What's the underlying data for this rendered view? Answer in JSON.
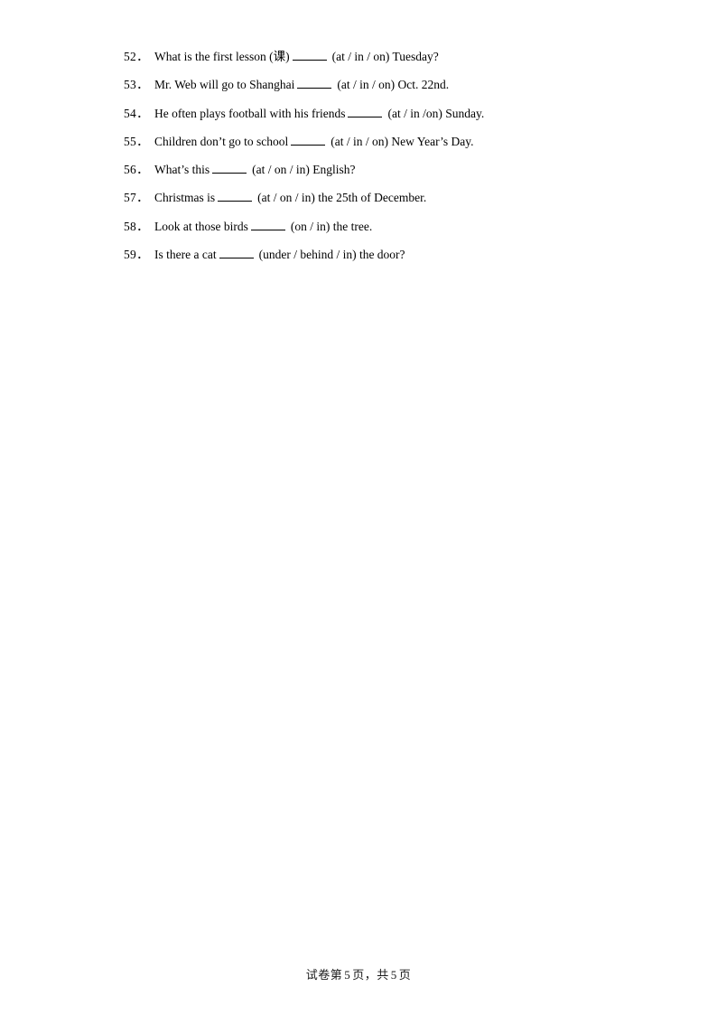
{
  "document": {
    "page_number": "5",
    "total_pages": "5",
    "background_color": "#ffffff",
    "text_color": "#000000"
  },
  "questions": [
    {
      "number": "52",
      "separator": "．",
      "before_blank": "What is the first lesson (课)",
      "after_blank": "(at / in / on) Tuesday?",
      "full_text": "52．What is the first lesson (课) _____ (at / in / on) Tuesday?"
    },
    {
      "number": "53",
      "separator": "．",
      "before_blank": "Mr. Web will go to Shanghai",
      "after_blank": "(at / in / on) Oct. 22nd.",
      "full_text": "53．Mr. Web will go to Shanghai _____ (at / in / on) Oct. 22nd."
    },
    {
      "number": "54",
      "separator": "．",
      "before_blank": "He often plays football with his friends",
      "after_blank": "(at / in /on) Sunday.",
      "full_text": "54．He often plays football with his friends _____ (at / in /on) Sunday."
    },
    {
      "number": "55",
      "separator": "．",
      "before_blank": "Children don’t go to school",
      "after_blank": "(at / in / on) New Year’s Day.",
      "full_text": "55．Children don’t go to school _____ (at / in / on) New Year’s Day."
    },
    {
      "number": "56",
      "separator": "．",
      "before_blank": "What’s this",
      "after_blank": "(at / on / in) English?",
      "full_text": "56．What’s this _____ (at / on / in) English?"
    },
    {
      "number": "57",
      "separator": "．",
      "before_blank": "Christmas is",
      "after_blank": "(at / on / in) the 25th of December.",
      "full_text": "57．Christmas is _____ (at / on / in) the 25th of December."
    },
    {
      "number": "58",
      "separator": "．",
      "before_blank": "Look at those birds",
      "after_blank": "(on / in) the tree.",
      "full_text": "58．Look at those birds _____ (on / in) the tree."
    },
    {
      "number": "59",
      "separator": "．",
      "before_blank": "Is there a cat",
      "after_blank": "(under / behind / in) the door?",
      "full_text": "59．Is there a cat _____ (under / behind / in) the door?"
    }
  ],
  "footer": {
    "prefix": "试卷第",
    "page_number": "5",
    "middle": "页，共",
    "total_pages": "5",
    "suffix": "页",
    "full_text": "试卷第 5 页，共 5 页"
  }
}
